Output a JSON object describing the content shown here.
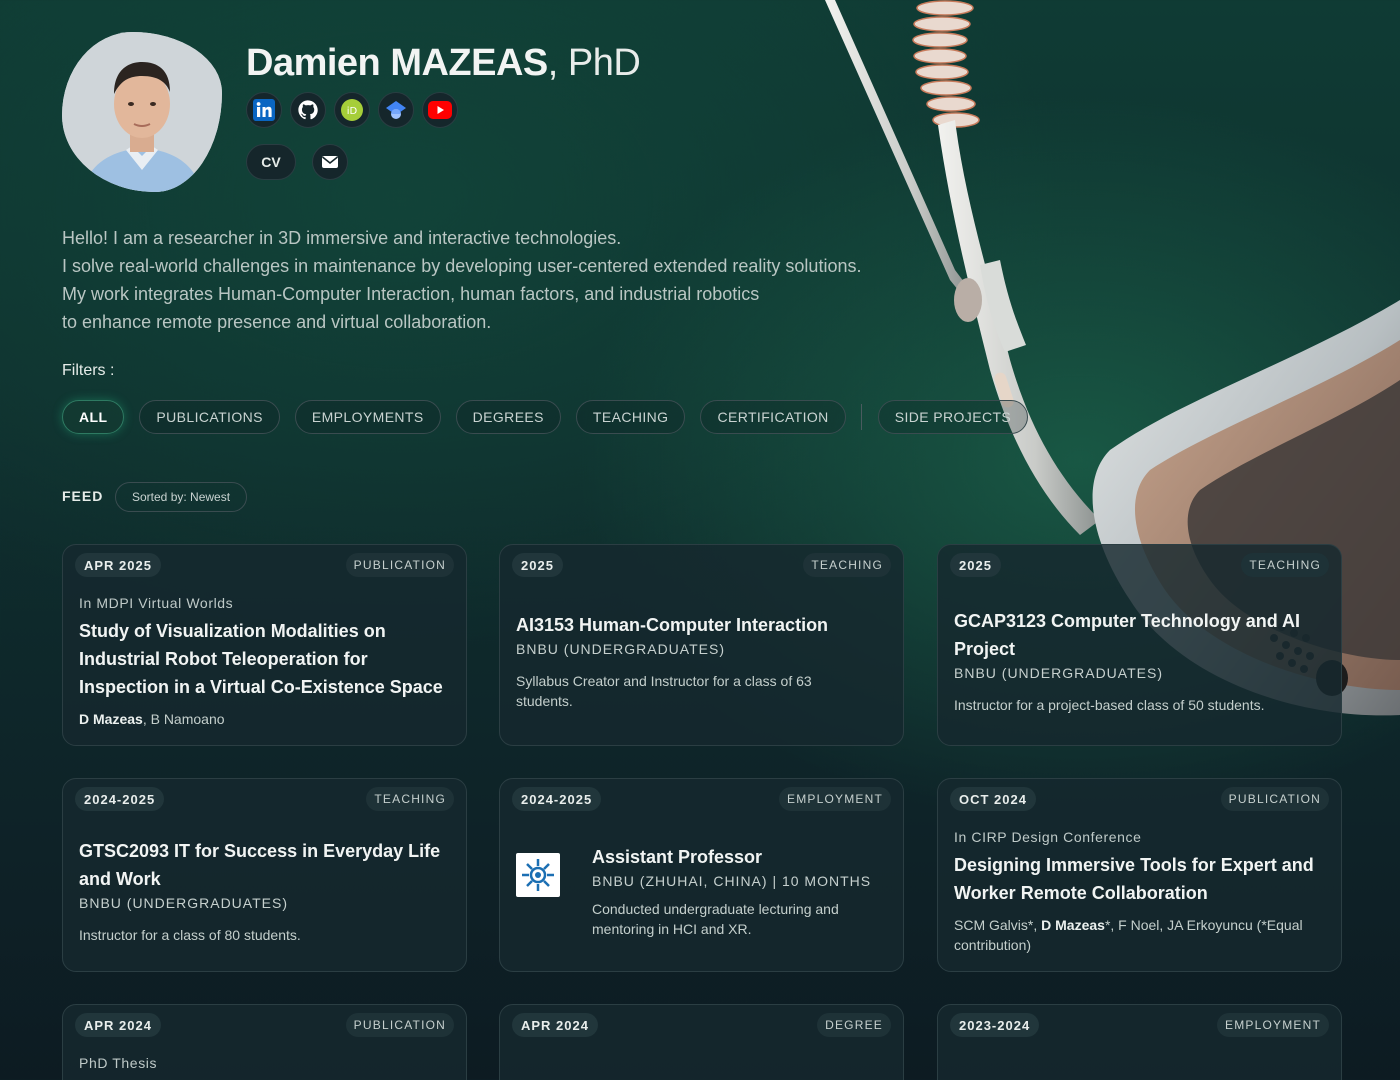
{
  "profile": {
    "name_main": "Damien MAZEAS",
    "name_suffix": ", PhD",
    "cv_label": "CV",
    "socials": [
      "linkedin-icon",
      "github-icon",
      "orcid-icon",
      "google-scholar-icon",
      "youtube-icon"
    ],
    "bio": [
      "Hello! I am a researcher in 3D immersive and interactive technologies.",
      "I solve real-world challenges in maintenance by developing user-centered extended reality solutions.",
      "My work integrates Human-Computer Interaction, human factors, and industrial robotics",
      "to enhance remote presence and virtual collaboration."
    ]
  },
  "filters": {
    "label": "Filters :",
    "items": [
      "ALL",
      "PUBLICATIONS",
      "EMPLOYMENTS",
      "DEGREES",
      "TEACHING",
      "CERTIFICATION",
      "SIDE PROJECTS"
    ],
    "active": "ALL"
  },
  "feed": {
    "label": "FEED",
    "sort": "Sorted by: Newest",
    "cards": [
      {
        "date": "APR 2025",
        "type": "PUBLICATION",
        "venue": "In MDPI Virtual Worlds",
        "title": "Study of Visualization Modalities on Industrial Robot Teleoperation for Inspection in a Virtual Co-Existence Space",
        "author_bold": "D Mazeas",
        "author_rest": ", B Namoano"
      },
      {
        "date": "2025",
        "type": "TEACHING",
        "title": "AI3153 Human-Computer Interaction",
        "sub": "BNBU (UNDERGRADUATES)",
        "body": "Syllabus Creator and Instructor for a class of 63 students."
      },
      {
        "date": "2025",
        "type": "TEACHING",
        "title": "GCAP3123 Computer Technology and AI Project",
        "sub": "BNBU (UNDERGRADUATES)",
        "body": "Instructor for a project-based class of 50 students."
      },
      {
        "date": "2024-2025",
        "type": "TEACHING",
        "title": "GTSC2093 IT for Success in Everyday Life and Work",
        "sub": "BNBU (UNDERGRADUATES)",
        "body": "Instructor for a class of 80 students."
      },
      {
        "date": "2024-2025",
        "type": "EMPLOYMENT",
        "title": "Assistant Professor",
        "sub": "BNBU (ZHUHAI, CHINA) | 10 MONTHS",
        "body": "Conducted undergraduate lecturing and mentoring in HCI and XR."
      },
      {
        "date": "OCT 2024",
        "type": "PUBLICATION",
        "venue": "In CIRP Design Conference",
        "title": "Designing Immersive Tools for Expert and Worker Remote Collaboration",
        "author_pre": "SCM Galvis*, ",
        "author_bold": "D Mazeas",
        "author_rest": "*, F Noel, JA Erkoyuncu (*Equal contribution)"
      },
      {
        "date": "APR 2024",
        "type": "PUBLICATION",
        "venue": "PhD Thesis"
      },
      {
        "date": "APR 2024",
        "type": "DEGREE"
      },
      {
        "date": "2023-2024",
        "type": "EMPLOYMENT"
      }
    ]
  },
  "colors": {
    "background": "#0f2f2e",
    "card": "#16282e",
    "accent": "#2e7a62"
  }
}
